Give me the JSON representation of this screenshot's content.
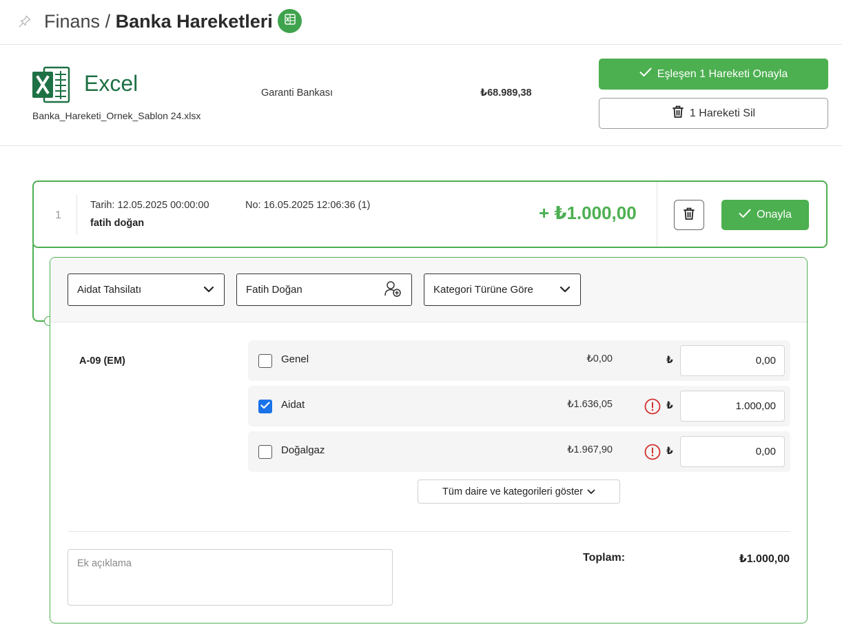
{
  "header": {
    "breadcrumb_parent": "Finans",
    "separator": "/",
    "breadcrumb_current": "Banka Hareketleri",
    "pin_icon": "pin-icon",
    "excel_badge_icon": "excel-icon"
  },
  "file": {
    "logo_word": "Excel",
    "file_name": "Banka_Hareketi_Ornek_Sablon 24.xlsx",
    "bank_name": "Garanti Bankası",
    "total": "₺68.989,38",
    "approve_all_label": "Eşleşen 1 Hareketi Onayla",
    "delete_all_label": "1 Hareketi Sil"
  },
  "transaction": {
    "index": "1",
    "date": "Tarih: 12.05.2025 00:00:00",
    "no": "No: 16.05.2025 12:06:36 (1)",
    "person": "fatih doğan",
    "amount": "+ ₺1.000,00",
    "approve_label": "Onayla"
  },
  "detail": {
    "category_select": "Aidat Tahsilatı",
    "person_select": "Fatih Doğan",
    "type_select": "Kategori Türüne Göre",
    "unit": "A-09 (EM)",
    "currency_symbol": "₺",
    "rows": [
      {
        "label": "Genel",
        "debt": "₺0,00",
        "amount": "0,00",
        "checked": false,
        "warning": false
      },
      {
        "label": "Aidat",
        "debt": "₺1.636,05",
        "amount": "1.000,00",
        "checked": true,
        "warning": true
      },
      {
        "label": "Doğalgaz",
        "debt": "₺1.967,90",
        "amount": "0,00",
        "checked": false,
        "warning": true
      }
    ],
    "show_all_label": "Tüm daire ve kategorileri göster",
    "note_placeholder": "Ek açıklama",
    "total_label": "Toplam:",
    "total_value": "₺1.000,00"
  },
  "colors": {
    "accent_green": "#4caf50",
    "excel_green": "#1e7145",
    "checkbox_blue": "#1a73e8",
    "warning_red": "#d32f2f"
  }
}
